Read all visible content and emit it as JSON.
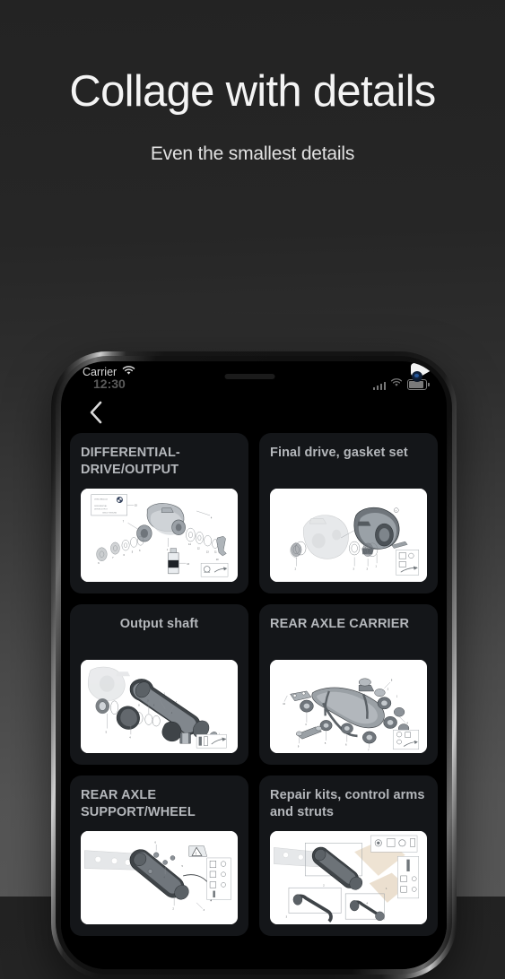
{
  "promo": {
    "title": "Collage with details",
    "subtitle": "Even the smallest details"
  },
  "phone": {
    "status_bar": {
      "carrier": "Carrier",
      "time": "12:30",
      "wifi_icon": "wifi-icon",
      "signal_icon": "cellular-signal-icon",
      "battery_icon": "battery-icon"
    },
    "nav": {
      "back_icon": "chevron-left-icon"
    },
    "grid": {
      "cards": [
        {
          "title": "DIFFERENTIAL-DRIVE/OUTPUT",
          "align": "left",
          "diagram": "differential-drive-output-diagram"
        },
        {
          "title": "Final drive, gasket set",
          "align": "left",
          "diagram": "final-drive-gasket-set-diagram"
        },
        {
          "title": "Output shaft",
          "align": "center",
          "diagram": "output-shaft-diagram"
        },
        {
          "title": "REAR AXLE CARRIER",
          "align": "left",
          "diagram": "rear-axle-carrier-diagram"
        },
        {
          "title": "REAR AXLE SUPPORT/WHEEL",
          "align": "left",
          "diagram": "rear-axle-support-wheel-diagram"
        },
        {
          "title": "Repair kits, control arms and struts",
          "align": "left",
          "diagram": "repair-kits-control-arms-struts-diagram"
        }
      ]
    }
  },
  "colors": {
    "background_top": "#232323",
    "background_bottom": "#575757",
    "card_background": "#141619",
    "card_title": "#b4b7bb",
    "screen_background": "#000000",
    "thumb_background": "#ffffff"
  }
}
